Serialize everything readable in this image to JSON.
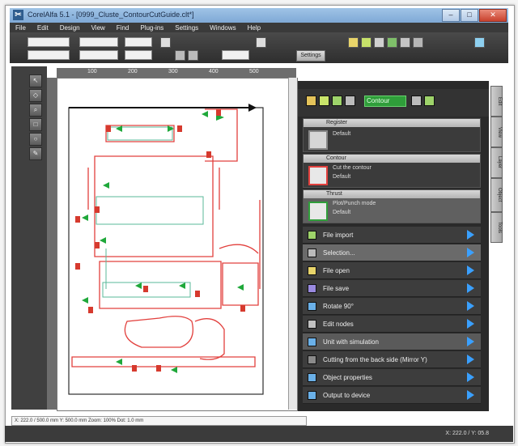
{
  "app": {
    "title": "CorelAlfa 5.1 - [0999_Cluste_ContourCutGuide.clt*]"
  },
  "window_buttons": [
    "–",
    "□",
    "✕"
  ],
  "menu": [
    "File",
    "Edit",
    "Design",
    "View",
    "Find",
    "Plug-ins",
    "Settings",
    "Windows",
    "Help"
  ],
  "toolbar": {
    "edit_button": "Settings"
  },
  "ruler": {
    "ticks": [
      "100",
      "200",
      "300",
      "400",
      "500"
    ]
  },
  "layers_panel": {
    "current_layer": "Contour",
    "layers": [
      {
        "name": "Register",
        "sub": "Default"
      },
      {
        "name": "Contour",
        "sub1": "Cut the contour",
        "sub2": "Default"
      },
      {
        "name": "Thrust",
        "sub1": "Plot/Punch mode",
        "sub2": "Default"
      }
    ]
  },
  "actions": [
    {
      "label": "File import"
    },
    {
      "label": "Selection..."
    },
    {
      "label": "File open"
    },
    {
      "label": "File save"
    },
    {
      "label": "Rotate 90°"
    },
    {
      "label": "Edit nodes"
    },
    {
      "label": "Unit with simulation"
    },
    {
      "label": "Cutting from the back side (Mirror Y)"
    },
    {
      "label": "Object properties"
    },
    {
      "label": "Output to device"
    }
  ],
  "side_tabs": [
    "Edit",
    "View",
    "Layer",
    "Object",
    "Tools"
  ],
  "status": {
    "text": "X: 222.0 / 500.0 mm   Y: 500.0 mm   Zoom: 100%   Dot: 1.0 mm"
  },
  "bottom": {
    "coords": "X: 222.0 / Y: 05.8"
  },
  "colors": {
    "accent": "#3aa0ff",
    "layer_green": "#2f9e3a",
    "contour_red": "#e2403d",
    "marker_green": "#1fa83a"
  }
}
